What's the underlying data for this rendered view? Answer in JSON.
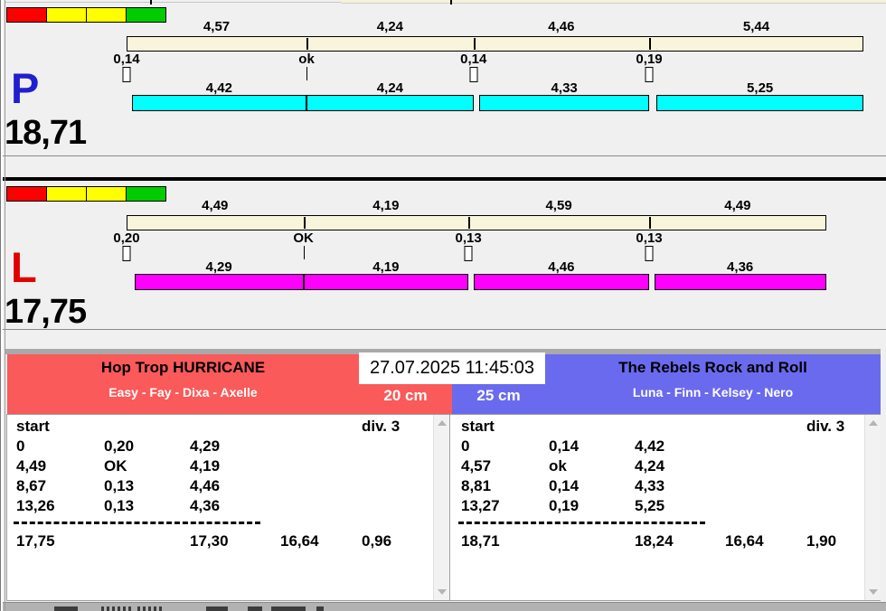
{
  "datetime": "27.07.2025 11:45:03",
  "colors": {
    "background": "#f0f0f0",
    "judge_bar_fill": "#f8f5dc",
    "separator": "#000000",
    "traffic_strip": [
      "#ff0000",
      "#ffff00",
      "#ffff00",
      "#00cc00"
    ],
    "lane_p_letter": "#2020d0",
    "lane_l_letter": "#e00000",
    "lane_p_dog_bar": "#00ffff",
    "lane_l_dog_bar": "#ff00ff",
    "team_left_bg": "#fa5a5a",
    "team_right_bg": "#6a6aee"
  },
  "lanes": [
    {
      "letter": "P",
      "total": "18,71",
      "splits": [
        "4,57",
        "4,24",
        "4,46",
        "5,44"
      ],
      "crossings": [
        "0,14",
        "ok",
        "0,14",
        "0,19"
      ],
      "dog_times": [
        "4,42",
        "4,24",
        "4,33",
        "5,25"
      ]
    },
    {
      "letter": "L",
      "total": "17,75",
      "splits": [
        "4,49",
        "4,19",
        "4,59",
        "4,49"
      ],
      "crossings": [
        "0,20",
        "OK",
        "0,13",
        "0,13"
      ],
      "dog_times": [
        "4,29",
        "4,19",
        "4,46",
        "4,36"
      ]
    }
  ],
  "teams": [
    {
      "name": "Hop Trop HURRICANE",
      "dogs": "Easy - Fay - Dixa - Axelle",
      "height": "20 cm"
    },
    {
      "name": "The Rebels Rock and Roll",
      "dogs": "Luna - Finn - Kelsey - Nero",
      "height": "25 cm"
    }
  ],
  "tables": [
    {
      "header_left": "start",
      "header_right": "div.  3",
      "rows": [
        [
          "0",
          "0,20",
          "4,29"
        ],
        [
          "4,49",
          "OK",
          "4,19"
        ],
        [
          "8,67",
          "0,13",
          "4,46"
        ],
        [
          "13,26",
          "0,13",
          "4,36"
        ]
      ],
      "totals": [
        "17,75",
        "17,30",
        "16,64",
        "0,96"
      ]
    },
    {
      "header_left": "start",
      "header_right": "div.  3",
      "rows": [
        [
          "0",
          "0,14",
          "4,42"
        ],
        [
          "4,57",
          "ok",
          "4,24"
        ],
        [
          "8,81",
          "0,14",
          "4,33"
        ],
        [
          "13,27",
          "0,19",
          "5,25"
        ]
      ],
      "totals": [
        "18,71",
        "18,24",
        "16,64",
        "1,90"
      ]
    }
  ]
}
